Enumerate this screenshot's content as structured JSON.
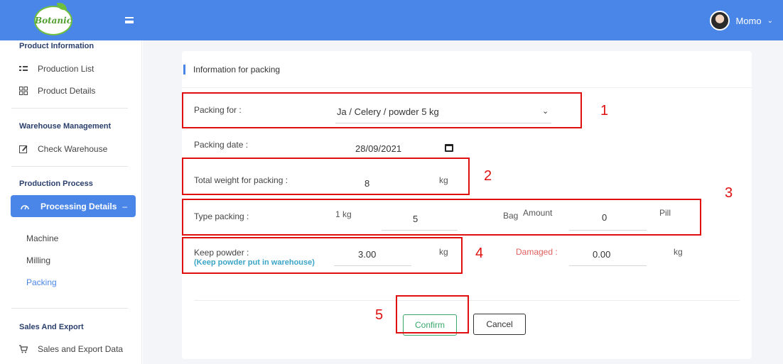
{
  "topbar": {
    "logo_text": "Botanic",
    "user_name": "Momo"
  },
  "sidebar": {
    "sections": [
      {
        "heading": "Product Information",
        "items": [
          "Production List",
          "Product Details"
        ]
      },
      {
        "heading": "Warehouse Management",
        "items": [
          "Check Warehouse"
        ]
      },
      {
        "heading": "Production Process",
        "active_item": "Processing Details",
        "active_suffix": "–",
        "sub_items": [
          "Machine",
          "Milling",
          "Packing"
        ]
      },
      {
        "heading": "Sales And Export",
        "items": [
          "Sales and Export Data"
        ]
      }
    ]
  },
  "form": {
    "title": "Information for packing",
    "packing_for": {
      "label": "Packing for :",
      "value": "Ja / Celery / powder 5 kg"
    },
    "packing_date": {
      "label": "Packing date :",
      "value": "28/09/2021"
    },
    "total_weight": {
      "label": "Total weight for packing :",
      "value": "8",
      "unit": "kg"
    },
    "type_packing": {
      "label": "Type packing :",
      "size": "1 kg",
      "value": "5",
      "unit": "Bag",
      "amount_label": "Amount",
      "amount_value": "0",
      "amount_unit": "Pill"
    },
    "keep_powder": {
      "label": "Keep powder :",
      "sublabel": "(Keep powder put in warehouse)",
      "value": "3.00",
      "unit": "kg"
    },
    "damaged": {
      "label": "Damaged :",
      "value": "0.00",
      "unit": "kg"
    },
    "confirm_label": "Confirm",
    "cancel_label": "Cancel"
  },
  "annotations": [
    "1",
    "2",
    "3",
    "4",
    "5"
  ],
  "colors": {
    "accent": "#4a86e8",
    "confirm": "#3aa86a",
    "annotation": "#e01010",
    "damaged": "#e36060"
  }
}
